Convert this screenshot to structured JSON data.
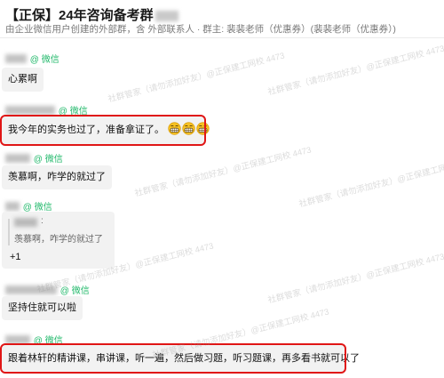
{
  "header": {
    "title": "【正保】24年咨询备考群",
    "subtitle": "由企业微信用户创建的外部群，含     外部联系人 · 群主: 裴裴老师（优惠券）(裴裴老师（优惠券）)"
  },
  "messages": [
    {
      "sender_tag": "@ 微信",
      "text": "心累啊"
    },
    {
      "sender_tag": "@ 微信",
      "text": "我今年的实务也过了，准备拿证了。",
      "emoji": [
        "grin-face-icon",
        "grin-face-icon",
        "grin-face-icon"
      ]
    },
    {
      "sender_tag": "@ 微信",
      "text": "羡慕啊，咋学的就过了"
    },
    {
      "sender_tag": "@ 微信",
      "quote": {
        "colon": ":",
        "text": "羡慕啊，咋学的就过了"
      },
      "reply": "+1"
    },
    {
      "sender_tag": "@ 微信",
      "text": "坚持住就可以啦"
    },
    {
      "sender_tag": "@ 微信",
      "text": "跟着林轩的精讲课，串讲课，听一遍，然后做习题，听习题课，再多看书就可以了"
    }
  ],
  "watermarks": [
    "社群管家（请勿添加好友）@正保建工网校 4473"
  ],
  "colors": {
    "highlight_box": "#e01616",
    "wechat_green": "#20b86a",
    "bubble_bg": "#f2f2f2"
  }
}
